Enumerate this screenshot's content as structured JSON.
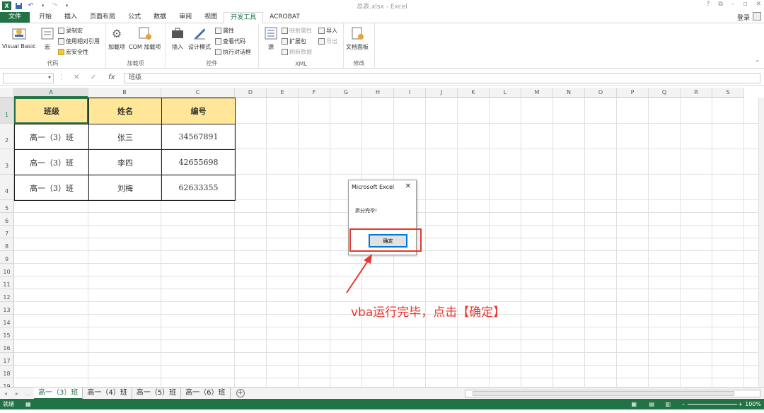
{
  "titlebar": {
    "title": "总表.xlsx - Excel",
    "help": "?",
    "restore_icon": "⧉",
    "minimize": "–",
    "maximize": "▫",
    "close": "✕"
  },
  "tabs": [
    {
      "label": "文件"
    },
    {
      "label": "开始"
    },
    {
      "label": "插入"
    },
    {
      "label": "页面布局"
    },
    {
      "label": "公式"
    },
    {
      "label": "数据"
    },
    {
      "label": "审阅"
    },
    {
      "label": "视图"
    },
    {
      "label": "开发工具"
    },
    {
      "label": "ACROBAT"
    }
  ],
  "account": {
    "login": "登录"
  },
  "ribbon": {
    "code": {
      "label": "代码",
      "vb": "Visual Basic",
      "macro": "宏",
      "record": "录制宏",
      "relative": "使用相对引用",
      "security": "宏安全性"
    },
    "addins": {
      "label": "加载项",
      "addins": "加载项",
      "com": "COM 加载项"
    },
    "controls": {
      "label": "控件",
      "insert": "插入",
      "design": "设计模式",
      "props": "属性",
      "viewcode": "查看代码",
      "dialog": "执行对话框"
    },
    "xml": {
      "label": "XML",
      "source": "源",
      "mapprops": "映射属性",
      "expand": "扩展包",
      "refresh": "刷新数据",
      "import": "导入",
      "export": "导出"
    },
    "modify": {
      "label": "修改",
      "docpanel": "文档面板"
    }
  },
  "formula_bar": {
    "namebox": "",
    "cancel": "✕",
    "enter": "✓",
    "fx": "fx",
    "content": "班级"
  },
  "columns": [
    "A",
    "B",
    "C",
    "D",
    "E",
    "F",
    "G",
    "H",
    "I",
    "J",
    "K",
    "L",
    "M",
    "N",
    "O",
    "P",
    "Q",
    "R",
    "S"
  ],
  "rows": [
    "1",
    "2",
    "3",
    "4",
    "5",
    "6",
    "7",
    "8",
    "9",
    "10",
    "11",
    "12",
    "13",
    "14",
    "15",
    "16",
    "17",
    "18",
    "19",
    "20"
  ],
  "table": {
    "header": [
      "班级",
      "姓名",
      "编号"
    ],
    "rows": [
      [
        "高一（3）班",
        "张三",
        "34567891"
      ],
      [
        "高一（3）班",
        "李四",
        "42655698"
      ],
      [
        "高一（3）班",
        "刘梅",
        "62633355"
      ]
    ]
  },
  "sheets": [
    "高一（3）班",
    "高一（4）班",
    "高一（5）班",
    "高一（6）班"
  ],
  "status": {
    "ready": "就绪",
    "zoom": "100%"
  },
  "dialog": {
    "title": "Microsoft Excel",
    "message": "拆分完毕!",
    "ok": "确定",
    "close": "✕"
  },
  "annotation": {
    "text": "vba运行完毕，点击【确定】"
  },
  "colors": {
    "excel_green": "#217346",
    "header_fill": "#ffe699",
    "annotation_red": "#e8352d"
  }
}
